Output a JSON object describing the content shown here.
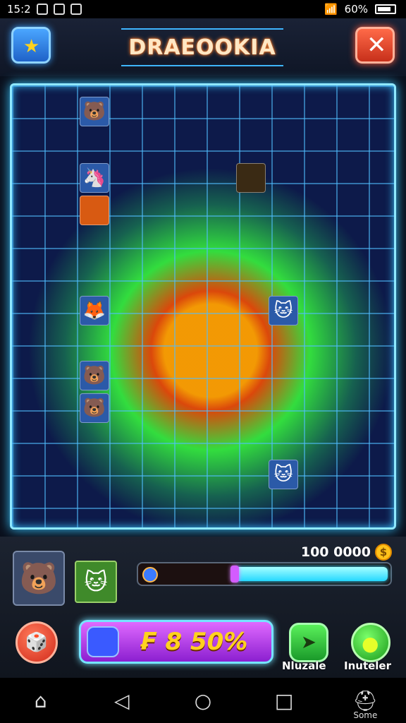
{
  "status_bar": {
    "time": "15:2",
    "battery": "60%"
  },
  "header": {
    "title": "DRAEOOKIA",
    "star_icon": "star-icon",
    "close_icon": "close-icon"
  },
  "board": {
    "pieces": [
      {
        "icon": "character-face-icon",
        "glyph": "🐻"
      },
      {
        "icon": "unicorn-icon",
        "glyph": "🦄"
      },
      {
        "icon": "fox-icon",
        "glyph": "🦊"
      },
      {
        "icon": "bear-icon",
        "glyph": "🐻"
      },
      {
        "icon": "cat-icon",
        "glyph": "🐱"
      },
      {
        "icon": "cat-icon-2",
        "glyph": "🐱"
      }
    ]
  },
  "panel": {
    "coins": "100 0000",
    "coin_symbol": "$",
    "progress_fill": 0.62,
    "boost_text": "₣ 8 50%",
    "button1_label": "Nluzale",
    "button2_label": "Inuteler"
  },
  "nav": {
    "home": "⌂",
    "back": "◁",
    "recents": "○",
    "square": "□",
    "profile_label": "Some"
  }
}
